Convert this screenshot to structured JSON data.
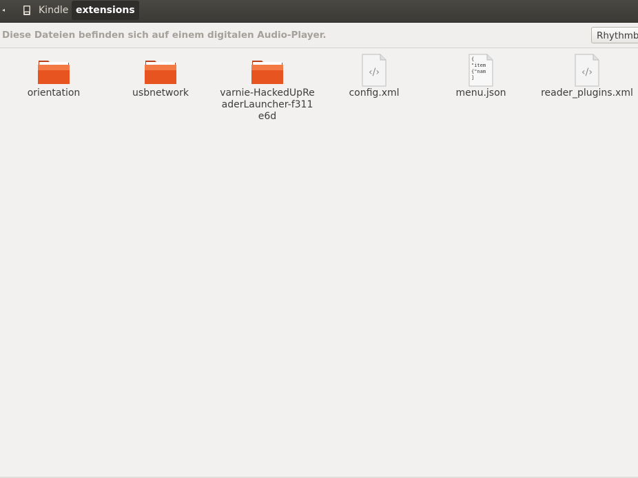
{
  "pathbar": {
    "crumbs": [
      {
        "label": "Kindle",
        "icon": "device-icon"
      },
      {
        "label": "extensions"
      }
    ]
  },
  "infobar": {
    "message": "Diese Dateien befinden sich auf einem digitalen Audio-Player.",
    "button_label": "Rhythmbox öffnen"
  },
  "files": [
    {
      "name": "orientation",
      "type": "folder"
    },
    {
      "name": "usbnetwork",
      "type": "folder"
    },
    {
      "name": "varnie-HackedUpReaderLauncher-f311e6d",
      "type": "folder"
    },
    {
      "name": "config.xml",
      "type": "xml"
    },
    {
      "name": "menu.json",
      "type": "json",
      "preview": [
        "{",
        "\"item",
        "{\"nam",
        "]"
      ]
    },
    {
      "name": "reader_plugins.xml",
      "type": "xml"
    }
  ],
  "colors": {
    "folder": "#e8541f",
    "pathbar_bg": "#3b3a36",
    "accent": "#dd4814"
  }
}
